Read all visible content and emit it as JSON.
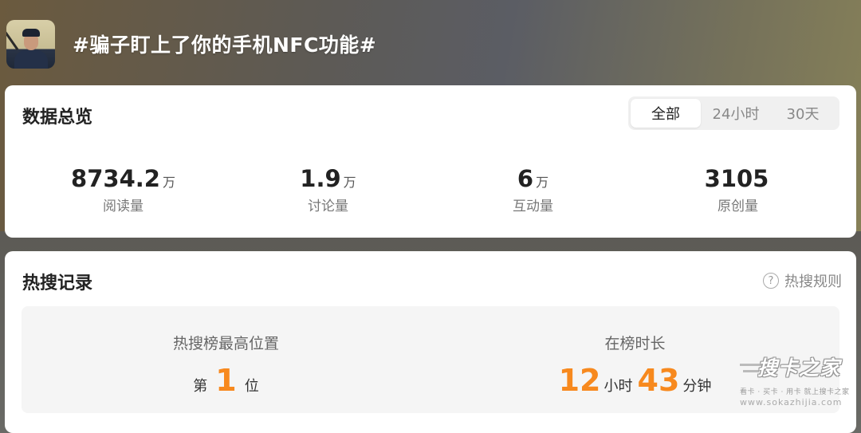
{
  "header": {
    "title": "#骗子盯上了你的手机NFC功能#",
    "avatar_icon": "police-officer-avatar"
  },
  "overview": {
    "title": "数据总览",
    "tabs": [
      {
        "label": "全部",
        "active": true
      },
      {
        "label": "24小时",
        "active": false
      },
      {
        "label": "30天",
        "active": false
      }
    ],
    "stats": [
      {
        "value": "8734.2",
        "unit": "万",
        "label": "阅读量"
      },
      {
        "value": "1.9",
        "unit": "万",
        "label": "讨论量"
      },
      {
        "value": "6",
        "unit": "万",
        "label": "互动量"
      },
      {
        "value": "3105",
        "unit": "",
        "label": "原创量"
      }
    ]
  },
  "hot_search": {
    "title": "热搜记录",
    "rules_label": "热搜规则",
    "rules_icon": "question-circle-icon",
    "highest_position": {
      "title": "热搜榜最高位置",
      "prefix": "第",
      "value": "1",
      "suffix": "位"
    },
    "duration": {
      "title": "在榜时长",
      "hours": "12",
      "hours_unit": "小时",
      "minutes": "43",
      "minutes_unit": "分钟"
    }
  },
  "watermark": {
    "logo": "搜卡之家",
    "tagline": "看卡 · 买卡 · 用卡 就上搜卡之家",
    "url": "www.sokazhijia.com"
  },
  "colors": {
    "accent_orange": "#f7891e",
    "card_bg": "#ffffff",
    "panel_bg": "#f5f5f5"
  }
}
